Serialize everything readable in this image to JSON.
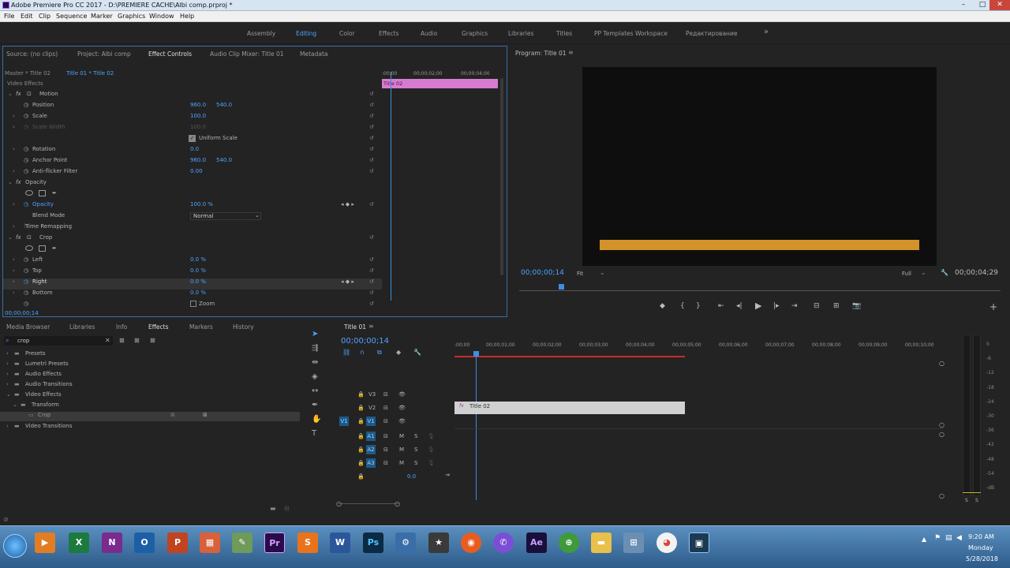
{
  "window": {
    "title": "Adobe Premiere Pro CC 2017 - D:\\PREMIERE CACHE\\Albi comp.prproj *",
    "min": "–",
    "max": "□",
    "close": "✕"
  },
  "menu": [
    "File",
    "Edit",
    "Clip",
    "Sequence",
    "Marker",
    "Graphics",
    "Window",
    "Help"
  ],
  "workspaces": [
    "Assembly",
    "Editing",
    "Color",
    "Effects",
    "Audio",
    "Graphics",
    "Libraries",
    "Titles",
    "PP Templates Workspace",
    "Редактирование"
  ],
  "workspaces_more": "»",
  "source_panel": {
    "tabs": [
      "Source: (no clips)",
      "Project: Albi comp",
      "Effect Controls",
      "Audio Clip Mixer: Title 01",
      "Metadata"
    ],
    "master": "Master * Title 02",
    "sequence_clip": "Title 01 * Title 02",
    "ruler": [
      ":00;00",
      "00;00;02;00",
      "00;00;04;00"
    ],
    "clip_label": "Title 02",
    "section": "Video Effects",
    "motion": "Motion",
    "position": "Position",
    "pos_x": "960.0",
    "pos_y": "540.0",
    "scale": "Scale",
    "scale_val": "100.0",
    "scale_width": "Scale Width",
    "scale_width_val": "100.0",
    "uniform_scale": "Uniform Scale",
    "rotation": "Rotation",
    "rotation_val": "0.0",
    "anchor": "Anchor Point",
    "anchor_x": "960.0",
    "anchor_y": "540.0",
    "antiflicker": "Anti-flicker Filter",
    "antiflicker_val": "0.00",
    "opacity_group": "Opacity",
    "opacity": "Opacity",
    "opacity_val": "100.0 %",
    "blend": "Blend Mode",
    "blend_val": "Normal",
    "time_remap": "Time Remapping",
    "crop": "Crop",
    "left": "Left",
    "left_val": "0.0 %",
    "top": "Top",
    "top_val": "0.0 %",
    "right": "Right",
    "right_val": "0.0 %",
    "bottom": "Bottom",
    "bottom_val": "0.0 %",
    "zoom": "Zoom",
    "timecode": "00;00;00;14"
  },
  "program": {
    "title": "Program: Title 01",
    "timecode": "00;00;00;14",
    "fit": "Fit",
    "full": "Full",
    "duration": "00;00;04;29",
    "bar_color": "#d4922a"
  },
  "effects_panel": {
    "tabs": [
      "Media Browser",
      "Libraries",
      "Info",
      "Effects",
      "Markers",
      "History"
    ],
    "search": "crop",
    "tree": [
      "Presets",
      "Lumetri Presets",
      "Audio Effects",
      "Audio Transitions",
      "Video Effects",
      "Transform",
      "Crop",
      "Video Transitions"
    ]
  },
  "timeline": {
    "tab": "Title 01",
    "timecode": "00;00;00;14",
    "ruler": [
      ":00;00",
      "00;00;01;00",
      "00;00;02;00",
      "00;00;03;00",
      "00;00;04;00",
      "00;00;05;00",
      "00;00;06;00",
      "00;00;07;00",
      "00;00;08;00",
      "00;00;09;00",
      "00;00;10;00"
    ],
    "tracks": {
      "v3": "V3",
      "v2": "V2",
      "v1": "V1",
      "v1src": "V1",
      "a1": "A1",
      "a2": "A2",
      "a3": "A3"
    },
    "master_val": "0.0",
    "clip": "Title 02",
    "m": "M",
    "s": "S"
  },
  "audio_meter": [
    "0",
    "-6",
    "-12",
    "-18",
    "-24",
    "-30",
    "-36",
    "-42",
    "-48",
    "-54",
    "-dB"
  ],
  "audio_meter_s": "S",
  "taskbar": {
    "time": "9:20 AM",
    "day": "Monday",
    "date": "5/28/2018",
    "apps": [
      "X",
      "N",
      "O",
      "P",
      "Pr",
      "S",
      "W",
      "Ps",
      "Ae"
    ]
  }
}
